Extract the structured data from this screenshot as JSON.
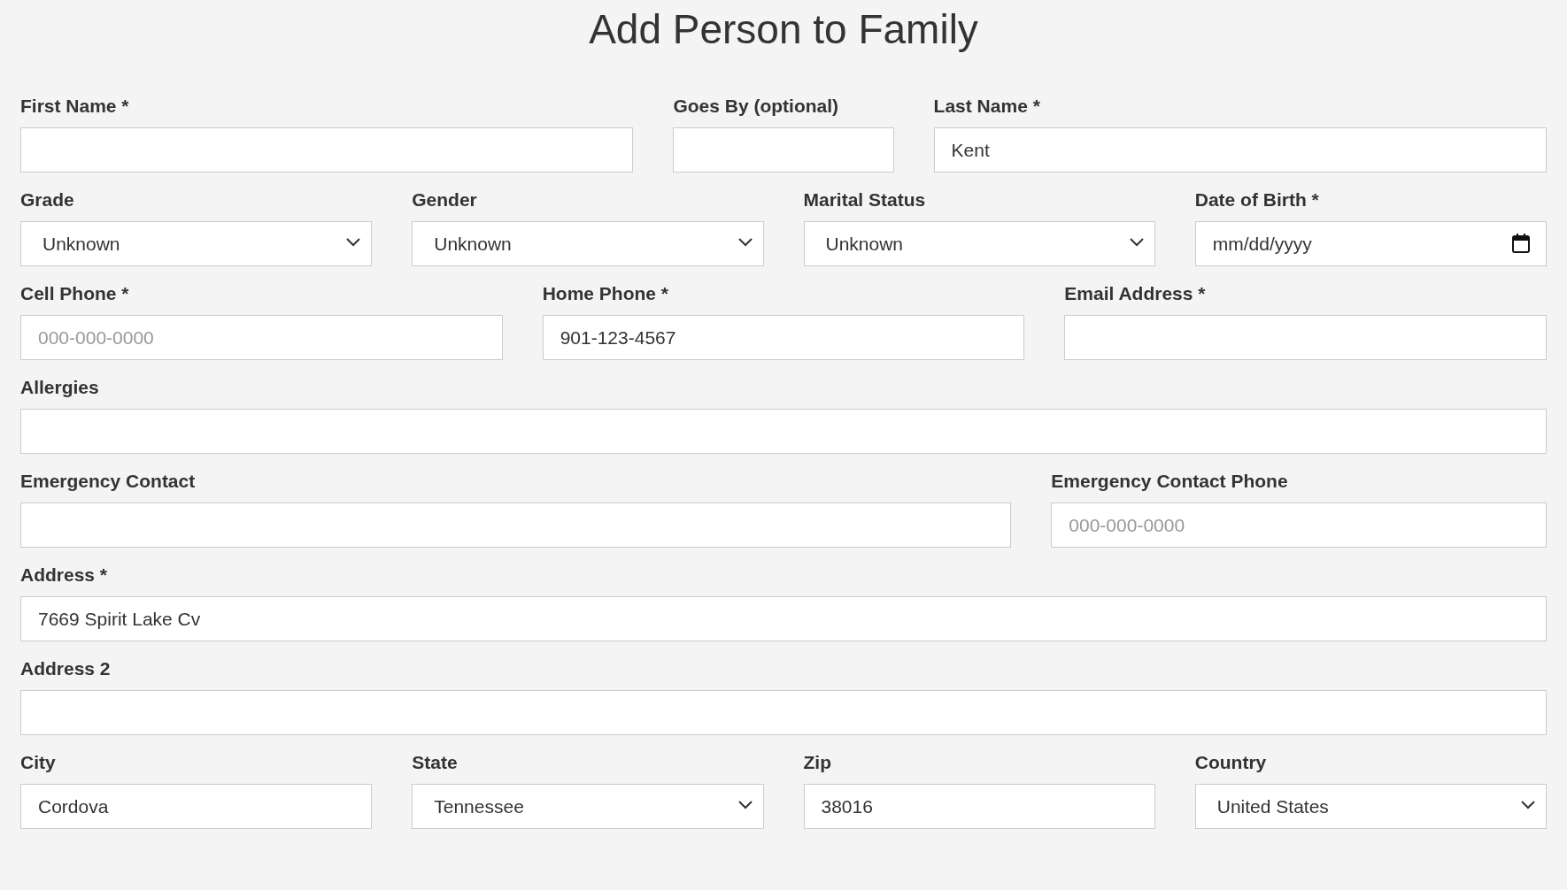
{
  "title": "Add Person to Family",
  "rows": [
    [
      {
        "label": "First Name *",
        "kind": "text"
      },
      {
        "label": "Goes By (optional)",
        "kind": "text"
      },
      {
        "label": "Last Name *",
        "kind": "text",
        "value": "Kent"
      }
    ],
    [
      {
        "label": "Grade",
        "kind": "select",
        "value": "Unknown"
      },
      {
        "label": "Gender",
        "kind": "select",
        "value": "Unknown"
      },
      {
        "label": "Marital Status",
        "kind": "select",
        "value": "Unknown"
      },
      {
        "label": "Date of Birth *",
        "kind": "date",
        "placeholder": "mm/dd/yyyy"
      }
    ],
    [
      {
        "label": "Cell Phone *",
        "kind": "text",
        "placeholder": "000-000-0000"
      },
      {
        "label": "Home Phone *",
        "kind": "text",
        "value": "901-123-4567"
      },
      {
        "label": "Email Address *",
        "kind": "text"
      }
    ],
    [
      {
        "label": "Allergies",
        "kind": "text"
      }
    ],
    [
      {
        "label": "Emergency Contact",
        "kind": "text"
      },
      {
        "label": "Emergency Contact Phone",
        "kind": "text",
        "placeholder": "000-000-0000"
      }
    ],
    [
      {
        "label": "Address *",
        "kind": "text",
        "value": "7669 Spirit Lake Cv"
      }
    ],
    [
      {
        "label": "Address 2",
        "kind": "text"
      }
    ],
    [
      {
        "label": "City",
        "kind": "text",
        "value": "Cordova"
      },
      {
        "label": "State",
        "kind": "select",
        "value": "Tennessee"
      },
      {
        "label": "Zip",
        "kind": "text",
        "value": "38016"
      },
      {
        "label": "Country",
        "kind": "select",
        "value": "United States"
      }
    ]
  ]
}
